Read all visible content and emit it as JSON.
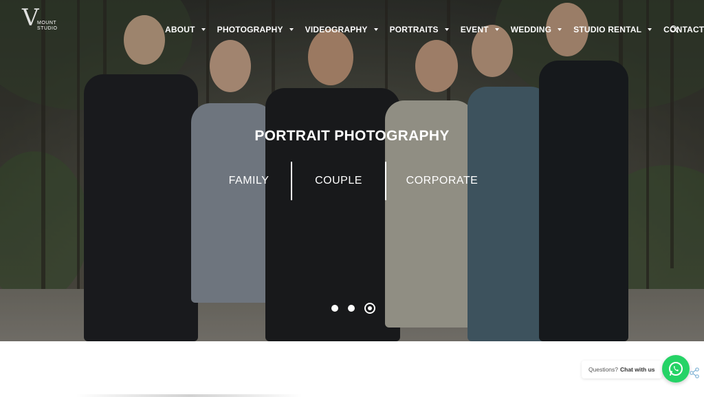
{
  "brand": {
    "logo_word": "MOUNT STUDIO",
    "logo_mark": "V"
  },
  "nav": {
    "items": [
      {
        "label": "ABOUT",
        "has_dropdown": true
      },
      {
        "label": "PHOTOGRAPHY",
        "has_dropdown": true
      },
      {
        "label": "VIDEOGRAPHY",
        "has_dropdown": true
      },
      {
        "label": "PORTRAITS",
        "has_dropdown": true
      },
      {
        "label": "EVENT",
        "has_dropdown": true
      },
      {
        "label": "WEDDING",
        "has_dropdown": true
      },
      {
        "label": "STUDIO RENTAL",
        "has_dropdown": true
      },
      {
        "label": "CONTACT",
        "has_dropdown": false
      }
    ],
    "search_icon": "search-icon"
  },
  "hero": {
    "title": "PORTRAIT PHOTOGRAPHY",
    "categories": [
      "FAMILY",
      "COUPLE",
      "CORPORATE"
    ],
    "slides_total": 3,
    "active_slide": 3
  },
  "chat": {
    "prompt": "Questions?",
    "action": "Chat with us",
    "icon": "whatsapp-icon",
    "color": "#25d366"
  }
}
